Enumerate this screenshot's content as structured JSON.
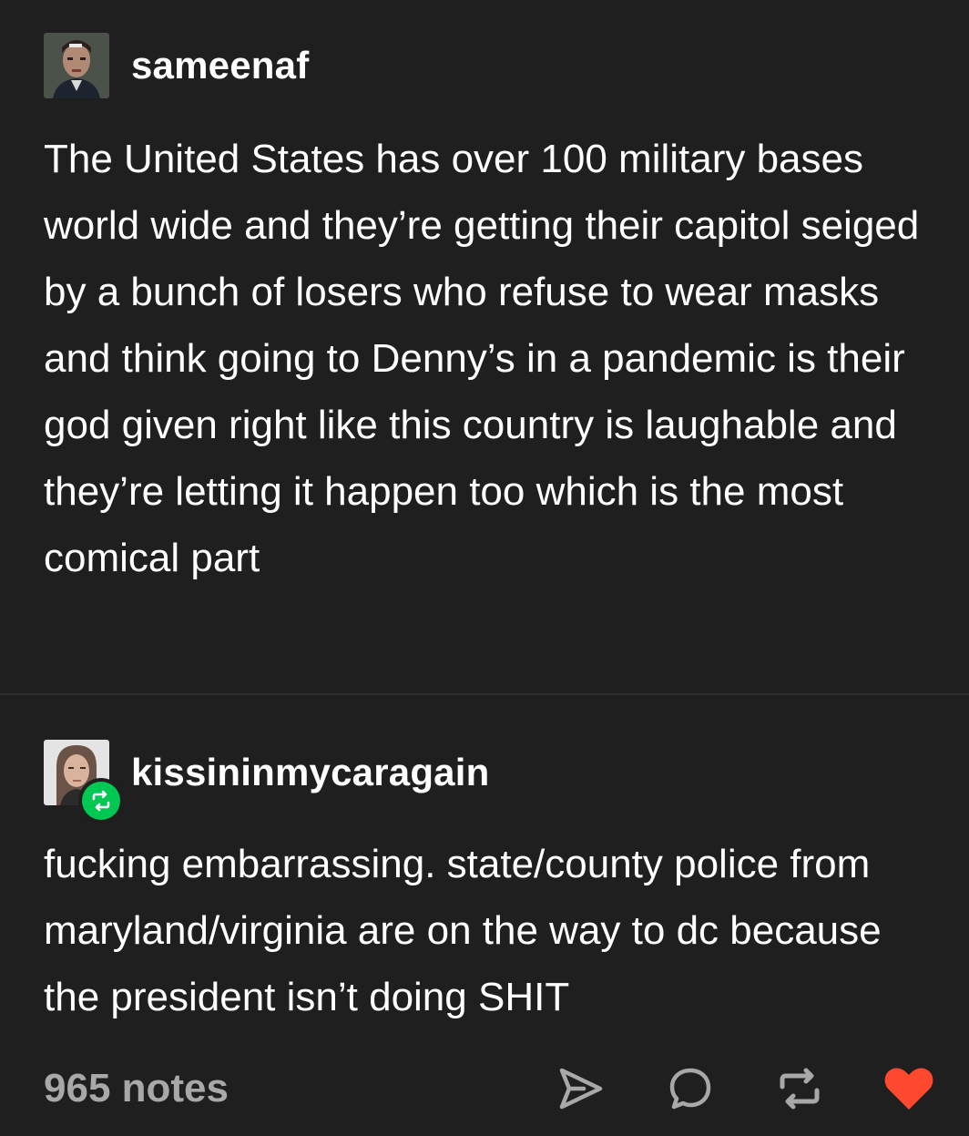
{
  "posts": [
    {
      "username": "sameenaf",
      "body": "The United States has over 100 military bases world wide and they’re getting their capitol seiged by a bunch of losers who refuse to wear masks and think going to Denny’s in a pandemic is their god given right like this country is laughable and they’re letting it happen too which is the most comical part"
    },
    {
      "username": "kissininmycaragain",
      "body": "fucking embarrassing. state/county police from maryland/virginia are on the way to dc because the president isn’t doing SHIT",
      "badge_icon": "reblog-icon"
    }
  ],
  "footer": {
    "notes": "965 notes",
    "actions": [
      "share-icon",
      "reply-icon",
      "reblog-icon",
      "like-icon"
    ]
  },
  "colors": {
    "background": "#1f1f1f",
    "text": "#ffffff",
    "muted": "#a8a8a8",
    "reblog_green": "#00c853",
    "like_red": "#ff492f",
    "divider": "#2f2f2f"
  }
}
